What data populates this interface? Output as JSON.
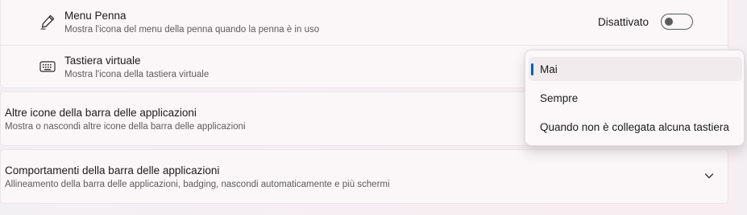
{
  "settings": {
    "pen_menu": {
      "icon": "pen-icon",
      "title": "Menu Penna",
      "description": "Mostra l'icona del menu della penna quando la penna è in uso",
      "toggle_state": "Disattivato",
      "toggle_on": false
    },
    "touch_keyboard": {
      "icon": "keyboard-icon",
      "title": "Tastiera virtuale",
      "description": "Mostra l'icona della tastiera virtuale"
    },
    "other_icons": {
      "title": "Altre icone della barra delle applicazioni",
      "description": "Mostra o nascondi altre icone della barra delle applicazioni"
    },
    "behaviors": {
      "title": "Comportamenti della barra delle applicazioni",
      "description": "Allineamento della barra delle applicazioni, badging, nascondi automaticamente e più schermi",
      "chevron_icon": "chevron-down-icon"
    }
  },
  "dropdown": {
    "selected": "Mai",
    "options": [
      "Mai",
      "Sempre",
      "Quando non è collegata alcuna tastiera"
    ]
  },
  "colors": {
    "accent": "#005fb8"
  }
}
